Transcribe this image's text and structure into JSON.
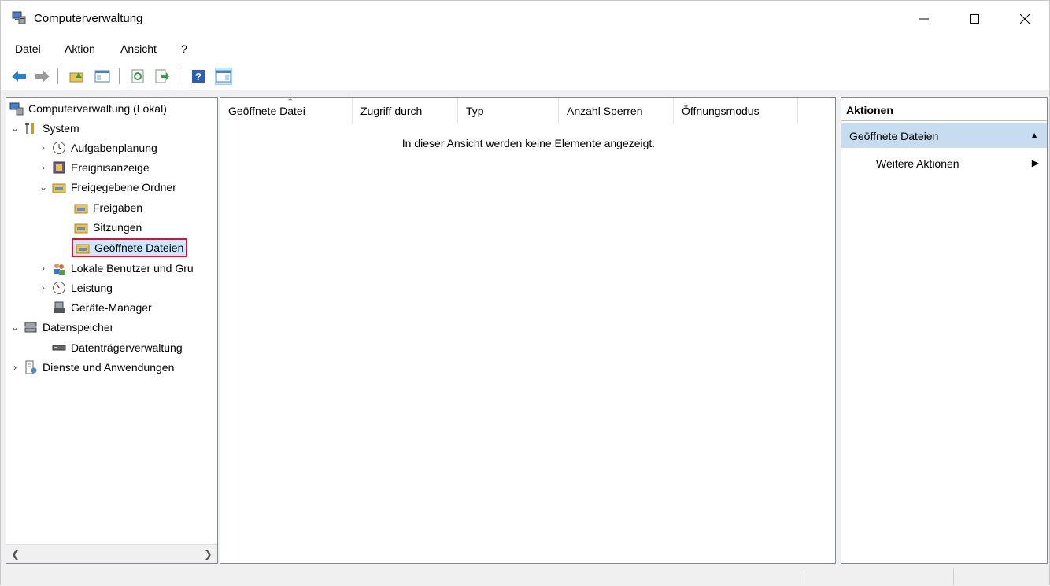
{
  "window": {
    "title": "Computerverwaltung"
  },
  "menu": {
    "items": [
      {
        "label": "Datei"
      },
      {
        "label": "Aktion"
      },
      {
        "label": "Ansicht"
      },
      {
        "label": "?"
      }
    ]
  },
  "tree": {
    "items": [
      {
        "label": "Computerverwaltung (Lokal)"
      },
      {
        "label": "System"
      },
      {
        "label": "Aufgabenplanung"
      },
      {
        "label": "Ereignisanzeige"
      },
      {
        "label": "Freigegebene Ordner"
      },
      {
        "label": "Freigaben"
      },
      {
        "label": "Sitzungen"
      },
      {
        "label": "Geöffnete Dateien"
      },
      {
        "label": "Lokale Benutzer und Gru"
      },
      {
        "label": "Leistung"
      },
      {
        "label": "Geräte-Manager"
      },
      {
        "label": "Datenspeicher"
      },
      {
        "label": "Datenträgerverwaltung"
      },
      {
        "label": "Dienste und Anwendungen"
      }
    ]
  },
  "list": {
    "columns": [
      {
        "label": "Geöffnete Datei"
      },
      {
        "label": "Zugriff durch"
      },
      {
        "label": "Typ"
      },
      {
        "label": "Anzahl Sperren"
      },
      {
        "label": "Öffnungsmodus"
      }
    ],
    "empty_message": "In dieser Ansicht werden keine Elemente angezeigt."
  },
  "actions": {
    "header": "Aktionen",
    "section": "Geöffnete Dateien",
    "item": "Weitere Aktionen"
  },
  "colors": {
    "selection_border": "#e0102a",
    "action_section_bg": "#c7dcef"
  }
}
